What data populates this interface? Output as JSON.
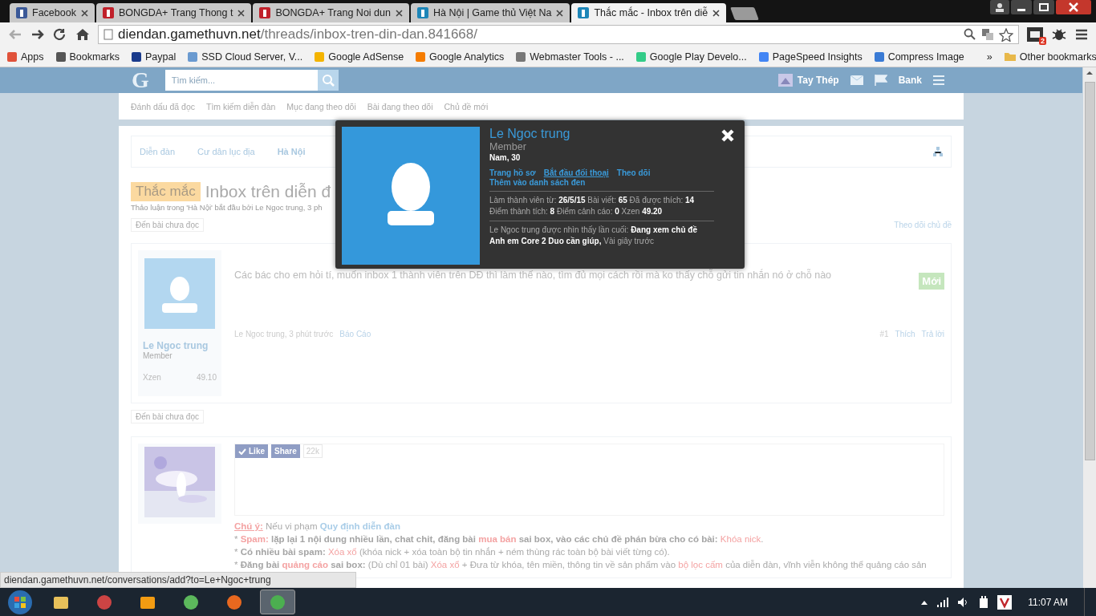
{
  "browser": {
    "tabs": [
      {
        "title": "Facebook",
        "selected": false
      },
      {
        "title": "BONGDA+ Trang Thong t",
        "selected": false
      },
      {
        "title": "BONGDA+ Trang Noi dun",
        "selected": false
      },
      {
        "title": "Hà Nội | Game thủ Việt Na",
        "selected": false
      },
      {
        "title": "Thắc mắc - Inbox trên diễ",
        "selected": true
      }
    ],
    "url_domain": "diendan.gamethuvn.net",
    "url_path": "/threads/inbox-tren-din-dan.841668/",
    "extension_badge": "2",
    "bookmarks": [
      {
        "label": "Apps"
      },
      {
        "label": "Bookmarks"
      },
      {
        "label": "Paypal"
      },
      {
        "label": "SSD Cloud Server, V..."
      },
      {
        "label": "Google AdSense"
      },
      {
        "label": "Google Analytics"
      },
      {
        "label": "Webmaster Tools - ..."
      },
      {
        "label": "Google Play Develo..."
      },
      {
        "label": "PageSpeed Insights"
      },
      {
        "label": "Compress Image"
      }
    ],
    "overflow": "»",
    "other_bookmarks": "Other bookmarks"
  },
  "forum": {
    "logo": "G",
    "search_placeholder": "Tìm kiếm...",
    "user": "Tay Thép",
    "account": "Bank",
    "nav": [
      "Đánh dấu đã đọc",
      "Tìm kiếm diễn đàn",
      "Mục đang theo dõi",
      "Bài đang theo dõi",
      "Chủ đề mới"
    ],
    "breadcrumbs": [
      {
        "label": "Diễn đàn",
        "current": false
      },
      {
        "label": "Cư dân lục địa",
        "current": false
      },
      {
        "label": "Hà Nội",
        "current": true
      }
    ],
    "thread": {
      "prefix": "Thắc mắc",
      "title": "Inbox trên diễn đ",
      "meta": "Thảo luận trong 'Hà Nội' bắt đầu bởi Le Ngoc trung, 3 ph",
      "unread_top": "Đến bài chưa đọc",
      "watch": "Theo dõi chủ đề",
      "unread_bottom": "Đến bài chưa đọc"
    },
    "post": {
      "author": "Le Ngoc trung",
      "role": "Member",
      "stat_label": "Xzen",
      "stat_value": "49.10",
      "message": "Các bác cho em hỏi tí, muốn inbox 1 thành viên trên DĐ thì làm thế nào, tìm đủ mọi cách rồi mà ko thấy chỗ gửi tin nhắn nó ở chỗ nào",
      "new_badge": "Mới",
      "byline": "Le Ngoc trung, 3 phút trước",
      "report": "Báo Cáo",
      "number": "#1",
      "like": "Thích",
      "reply": "Trả lời"
    },
    "ad_post": {
      "avatar": {
        "kind": "picture"
      },
      "like": "Like",
      "share": "Share",
      "count": "22k",
      "rules": [
        [
          {
            "kind": "alert",
            "text": "Chú ý:"
          },
          {
            "kind": "plain",
            "text": " Nếu vi phạm "
          },
          {
            "kind": "link",
            "text": "Quy định diễn đàn"
          }
        ],
        [
          {
            "kind": "plain",
            "text": "* "
          },
          {
            "kind": "redbold",
            "text": "Spam:"
          },
          {
            "kind": "bold",
            "text": " lặp lại 1 nội dung nhiều lần, chat chit, đăng bài "
          },
          {
            "kind": "redbold",
            "text": "mua bán"
          },
          {
            "kind": "bold",
            "text": " sai box, vào các chủ đề phán bừa cho có bài: "
          },
          {
            "kind": "red",
            "text": "Khóa nick"
          },
          {
            "kind": "plain",
            "text": "."
          }
        ],
        [
          {
            "kind": "plain",
            "text": "* "
          },
          {
            "kind": "bold",
            "text": "Có nhiều bài spam: "
          },
          {
            "kind": "red",
            "text": "Xóa xổ"
          },
          {
            "kind": "plain",
            "text": " (khóa nick + xóa toàn bộ tin nhắn + ném thùng rác toàn bộ bài viết từng có)."
          }
        ],
        [
          {
            "kind": "plain",
            "text": "* "
          },
          {
            "kind": "bold",
            "text": "Đăng bài "
          },
          {
            "kind": "redbold",
            "text": "quảng cáo"
          },
          {
            "kind": "bold",
            "text": " sai box:"
          },
          {
            "kind": "plain",
            "text": " (Dù chỉ 01 bài) "
          },
          {
            "kind": "red",
            "text": "Xóa xổ"
          },
          {
            "kind": "plain",
            "text": " + Đưa từ khóa, tên miền, thông tin về sản phẩm vào "
          },
          {
            "kind": "red",
            "text": "bộ lọc cấm"
          },
          {
            "kind": "plain",
            "text": " của diễn đàn, vĩnh viễn không thể quảng cáo sản"
          }
        ]
      ]
    }
  },
  "popup": {
    "name": "Le Ngoc trung",
    "title": "Member",
    "info": "Nam, 30",
    "links": [
      {
        "label": "Trang hồ sơ",
        "hovered": false
      },
      {
        "label": "Bắt đầu đối thoại",
        "hovered": true
      },
      {
        "label": "Theo dõi",
        "hovered": false
      },
      {
        "label": "Thêm vào danh sách đen",
        "hovered": false
      }
    ],
    "stats": "Làm thành viên từ: **26/5/15**  Bài viết: **65**  Đã được thích: **14**  Điểm thành tích: **8**  Điểm cảnh cáo: **0**  Xzen **49.20**",
    "last_seen": "Le Ngoc trung được nhìn thấy lần cuối: **Đang xem chủ đề Anh em Core 2 Duo cần giúp,** Vài giây trước"
  },
  "status_url": "diendan.gamethuvn.net/conversations/add?to=Le+Ngoc+trung",
  "taskbar": {
    "apps": [
      {
        "kind": "folder",
        "selected": false
      },
      {
        "kind": "paint",
        "selected": false
      },
      {
        "kind": "player",
        "selected": false
      },
      {
        "kind": "green",
        "selected": false
      },
      {
        "kind": "firefox",
        "selected": false
      },
      {
        "kind": "chrome",
        "selected": true
      }
    ],
    "clock": "11:07 AM"
  }
}
